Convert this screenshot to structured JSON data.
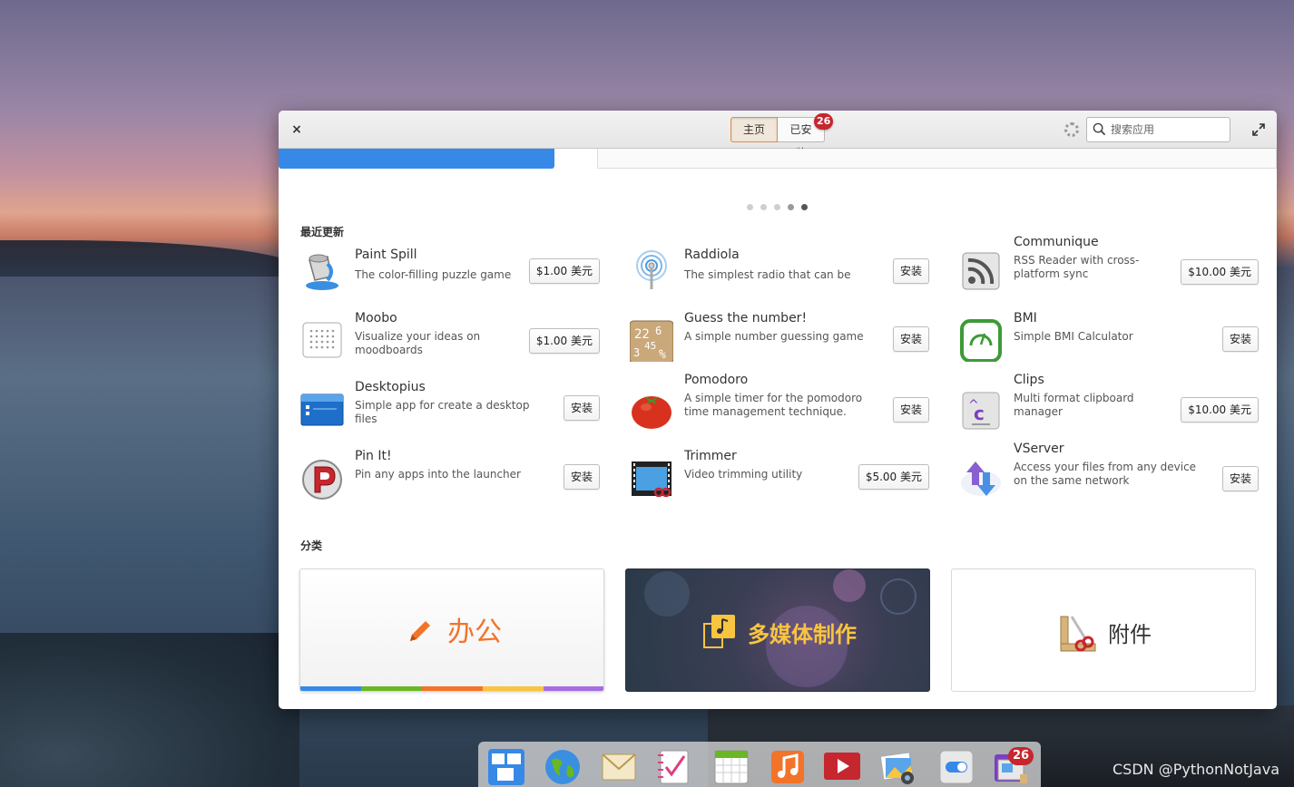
{
  "header": {
    "close_label": "×",
    "tabs": [
      {
        "label": "主页",
        "active": true
      },
      {
        "label": "已安装",
        "active": false
      }
    ],
    "installed_badge": "26",
    "search_placeholder": "搜索应用"
  },
  "banner": {
    "page_count": 5,
    "active_page": 5
  },
  "recent": {
    "title": "最近更新",
    "apps": [
      {
        "name": "Paint Spill",
        "desc": "The color-filling puzzle game",
        "action": "$1.00 美元",
        "icon": "paint-spill-icon"
      },
      {
        "name": "Raddiola",
        "desc": "The simplest radio that can be",
        "action": "安装",
        "icon": "raddiola-icon"
      },
      {
        "name": "Communique",
        "desc": "RSS Reader with cross-platform sync",
        "action": "$10.00 美元",
        "icon": "communique-icon"
      },
      {
        "name": "Moobo",
        "desc": "Visualize your ideas on moodboards",
        "action": "$1.00 美元",
        "icon": "moobo-icon"
      },
      {
        "name": "Guess the number!",
        "desc": "A simple number guessing game",
        "action": "安装",
        "icon": "guess-number-icon"
      },
      {
        "name": "BMI",
        "desc": "Simple BMI Calculator",
        "action": "安装",
        "icon": "bmi-icon"
      },
      {
        "name": "Desktopius",
        "desc": "Simple app for create a desktop files",
        "action": "安装",
        "icon": "desktopius-icon"
      },
      {
        "name": "Pomodoro",
        "desc": "A simple timer for the pomodoro time management technique.",
        "action": "安装",
        "icon": "pomodoro-icon"
      },
      {
        "name": "Clips",
        "desc": "Multi format clipboard manager",
        "action": "$10.00 美元",
        "icon": "clips-icon"
      },
      {
        "name": "Pin It!",
        "desc": "Pin any apps into the launcher",
        "action": "安装",
        "icon": "pin-it-icon"
      },
      {
        "name": "Trimmer",
        "desc": "Video trimming utility",
        "action": "$5.00 美元",
        "icon": "trimmer-icon"
      },
      {
        "name": "VServer",
        "desc": "Access your files from any device on the same network",
        "action": "安装",
        "icon": "vserver-icon"
      }
    ]
  },
  "categories": {
    "title": "分类",
    "items": [
      {
        "label": "办公",
        "icon": "pencil-icon"
      },
      {
        "label": "多媒体制作",
        "icon": "media-production-icon"
      },
      {
        "label": "附件",
        "icon": "accessories-icon"
      }
    ]
  },
  "dock": {
    "badge": "26",
    "items": [
      "multitasking-view-icon",
      "web-browser-icon",
      "mail-icon",
      "tasks-icon",
      "calendar-icon",
      "music-icon",
      "videos-icon",
      "photos-icon",
      "system-settings-icon",
      "appcenter-icon"
    ]
  },
  "watermark": "CSDN @PythonNotJava",
  "colors": {
    "accent": "#3689e6",
    "badge": "#c6262e",
    "office_orange": "#f37329",
    "media_yellow": "#f9c440"
  }
}
